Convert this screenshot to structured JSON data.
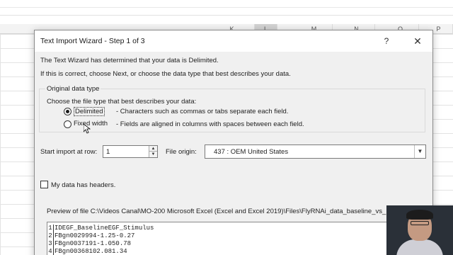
{
  "excel": {
    "columns": [
      "K",
      "L",
      "M",
      "N",
      "O",
      "P"
    ]
  },
  "dialog": {
    "title": "Text Import Wizard - Step 1 of 3",
    "help_label": "?",
    "close_label": "✕",
    "intro_line1": "The Text Wizard has determined that your data is Delimited.",
    "intro_line2": "If this is correct, choose Next, or choose the data type that best describes your data.",
    "original_data_type": {
      "group_label": "Original data type",
      "choose_label": "Choose the file type that best describes your data:",
      "delimited_label": "Delimited",
      "delimited_desc": "- Characters such as commas or tabs separate each field.",
      "fixed_width_label": "Fixed width",
      "fixed_width_desc": "- Fields are aligned in columns with spaces between each field.",
      "selected": "Delimited"
    },
    "start_import": {
      "label": "Start import at row:",
      "value": "1"
    },
    "file_origin": {
      "label": "File origin:",
      "value": "437 : OEM United States"
    },
    "headers_checkbox": {
      "label": "My data has headers.",
      "checked": false
    },
    "preview": {
      "label": "Preview of file C:\\Videos Canal\\MO-200 Microsoft Excel (Excel and Excel 2019)\\Files\\FlyRNAi_data_baseline_vs_EGF.txt.",
      "rows": [
        {
          "num": "1",
          "text": "IDEGF_BaselineEGF_Stimulus"
        },
        {
          "num": "2",
          "text": "FBgn0029994-1.25-0.27"
        },
        {
          "num": "3",
          "text": "FBgn0037191-1.050.78"
        },
        {
          "num": "4",
          "text": "FBgn00368102.081.34"
        }
      ]
    }
  },
  "colors": {
    "dialog_bg": "#f0f0f0",
    "titlebar_bg": "#ffffff",
    "grid_line": "#e3e3e3"
  }
}
